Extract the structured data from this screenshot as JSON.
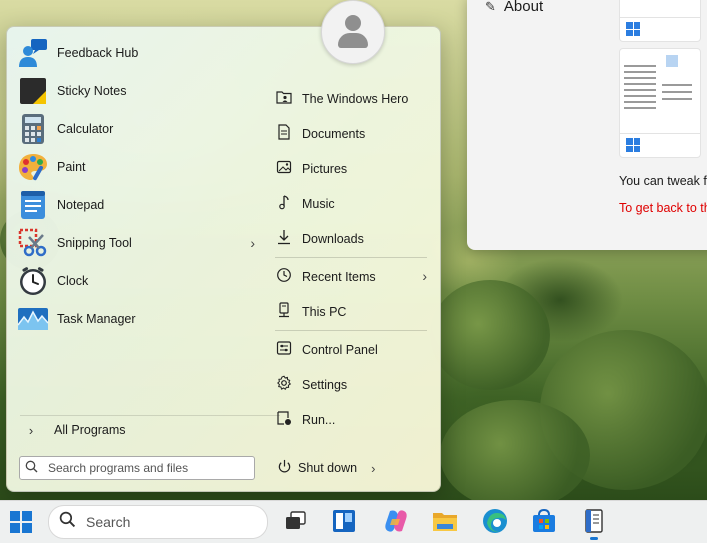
{
  "background_window": {
    "about_label": "About",
    "text_line1": "You can tweak fu",
    "text_line2": "To get back to th",
    "text_line2_color": "#e00000"
  },
  "start_menu": {
    "programs": [
      {
        "label": "Feedback Hub",
        "icon": "feedback-hub-icon"
      },
      {
        "label": "Sticky Notes",
        "icon": "sticky-notes-icon"
      },
      {
        "label": "Calculator",
        "icon": "calculator-icon"
      },
      {
        "label": "Paint",
        "icon": "paint-icon"
      },
      {
        "label": "Notepad",
        "icon": "notepad-icon"
      },
      {
        "label": "Snipping Tool",
        "icon": "snipping-tool-icon",
        "has_submenu": true
      },
      {
        "label": "Clock",
        "icon": "clock-icon"
      },
      {
        "label": "Task Manager",
        "icon": "task-manager-icon"
      }
    ],
    "all_programs_label": "All Programs",
    "search_placeholder": "Search programs and files",
    "places": [
      {
        "label": "The Windows Hero",
        "icon": "user-folder-icon"
      },
      {
        "label": "Documents",
        "icon": "document-icon"
      },
      {
        "label": "Pictures",
        "icon": "picture-icon"
      },
      {
        "label": "Music",
        "icon": "music-icon"
      },
      {
        "label": "Downloads",
        "icon": "download-icon"
      },
      {
        "label": "Recent Items",
        "icon": "clock-icon",
        "has_submenu": true
      },
      {
        "label": "This PC",
        "icon": "computer-icon"
      },
      {
        "label": "Control Panel",
        "icon": "control-panel-icon"
      },
      {
        "label": "Settings",
        "icon": "gear-icon"
      },
      {
        "label": "Run...",
        "icon": "run-icon"
      }
    ],
    "shutdown_label": "Shut down"
  },
  "taskbar": {
    "search_label": "Search",
    "accent": "#1976d2",
    "icons": [
      "task-view-icon",
      "widgets-icon",
      "copilot-icon",
      "file-explorer-icon",
      "edge-icon",
      "store-icon",
      "notebook-app-icon"
    ]
  }
}
